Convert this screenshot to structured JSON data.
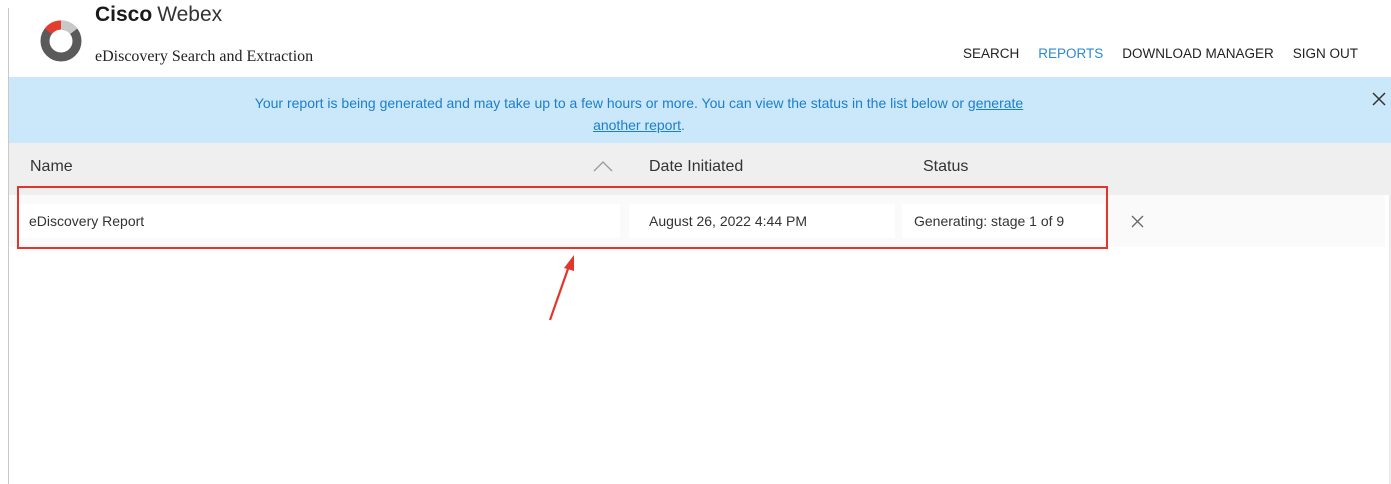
{
  "brand": {
    "name_bold": "Cisco",
    "name_rest": "Webex",
    "subtitle": "eDiscovery Search and Extraction"
  },
  "nav": {
    "items": [
      {
        "label": "SEARCH",
        "active": false
      },
      {
        "label": "REPORTS",
        "active": true
      },
      {
        "label": "DOWNLOAD MANAGER",
        "active": false
      },
      {
        "label": "SIGN OUT",
        "active": false
      }
    ],
    "active_color": "#2a8ad6"
  },
  "banner": {
    "text_before": "Your report is being generated and may take up to a few hours or more. You can view the status in the list below or ",
    "link_text_1": "generate",
    "link_text_2": "another report",
    "text_after": ".",
    "close_icon": "close-icon",
    "background": "#cbe7fa",
    "text_color": "#1b7fcc"
  },
  "table": {
    "columns": [
      {
        "label": "Name",
        "sort_icon": "chevron-up-icon"
      },
      {
        "label": "Date Initiated"
      },
      {
        "label": "Status"
      }
    ],
    "rows": [
      {
        "name": "eDiscovery Report",
        "date": "August 26, 2022 4:44 PM",
        "status": "Generating: stage 1 of 9",
        "action_icon": "close-icon"
      }
    ]
  },
  "annotation": {
    "highlight_color": "#e2362c"
  }
}
